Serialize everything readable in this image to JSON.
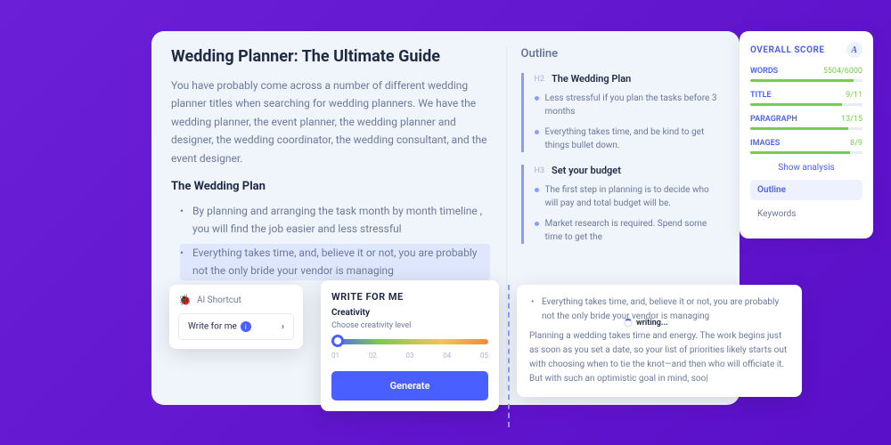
{
  "editor": {
    "title": "Wedding Planner: The Ultimate Guide",
    "paragraph": "You have probably come across a number of different wedding planner titles when searching for wedding planners. We have the wedding planner, the event planner, the wedding planner and designer, the wedding coordinator, the wedding consultant, and the event designer.",
    "subheading": "The Wedding Plan",
    "bullets": [
      "By planning and arranging the task month by month timeline , you will find the job easier and less stressful",
      "Everything takes time, and, believe it or not, you are probably not the only bride your vendor is managing"
    ]
  },
  "outline": {
    "heading": "Outline",
    "groups": [
      {
        "tag": "H2",
        "title": "The Wedding Plan",
        "items": [
          "Less stressful if you plan the tasks before 3 months",
          "Everything takes time, and be kind to get things bullet down."
        ]
      },
      {
        "tag": "H3",
        "title": "Set your budget",
        "items": [
          "The first step in planning is to decide who will pay and total budget will be.",
          "Market research is required. Spend some time to get the"
        ]
      }
    ]
  },
  "score": {
    "heading": "OVERALL SCORE",
    "grade": "A",
    "metrics": [
      {
        "label": "WORDS",
        "value": "5504/6000",
        "pct": 92
      },
      {
        "label": "TITLE",
        "value": "9/11",
        "pct": 82
      },
      {
        "label": "PARAGRAPH",
        "value": "13/15",
        "pct": 87
      },
      {
        "label": "IMAGES",
        "value": "8/9",
        "pct": 89
      }
    ],
    "show": "Show analysis",
    "tabs": [
      "Outline",
      "Keywords"
    ]
  },
  "shortcut": {
    "heading": "AI Shortcut",
    "button": "Write for me",
    "emoji": "🐞"
  },
  "wfm": {
    "heading": "WRITE FOR ME",
    "sub": "Creativity",
    "desc": "Choose creativity level",
    "ticks": [
      "01",
      "02",
      "03",
      "04",
      "05"
    ],
    "generate": "Generate"
  },
  "preview": {
    "bullet": "Everything takes time, and, believe it or not, you are probably not the only bride your vendor is managing",
    "body": "Planning a wedding takes time and energy. The work begins just as soon as you set a date, so your list of priorities likely starts out with choosing when to tie the knot—and then who will officiate it. But with such an optimistic goal in mind, soo|"
  },
  "writing": "writing..."
}
